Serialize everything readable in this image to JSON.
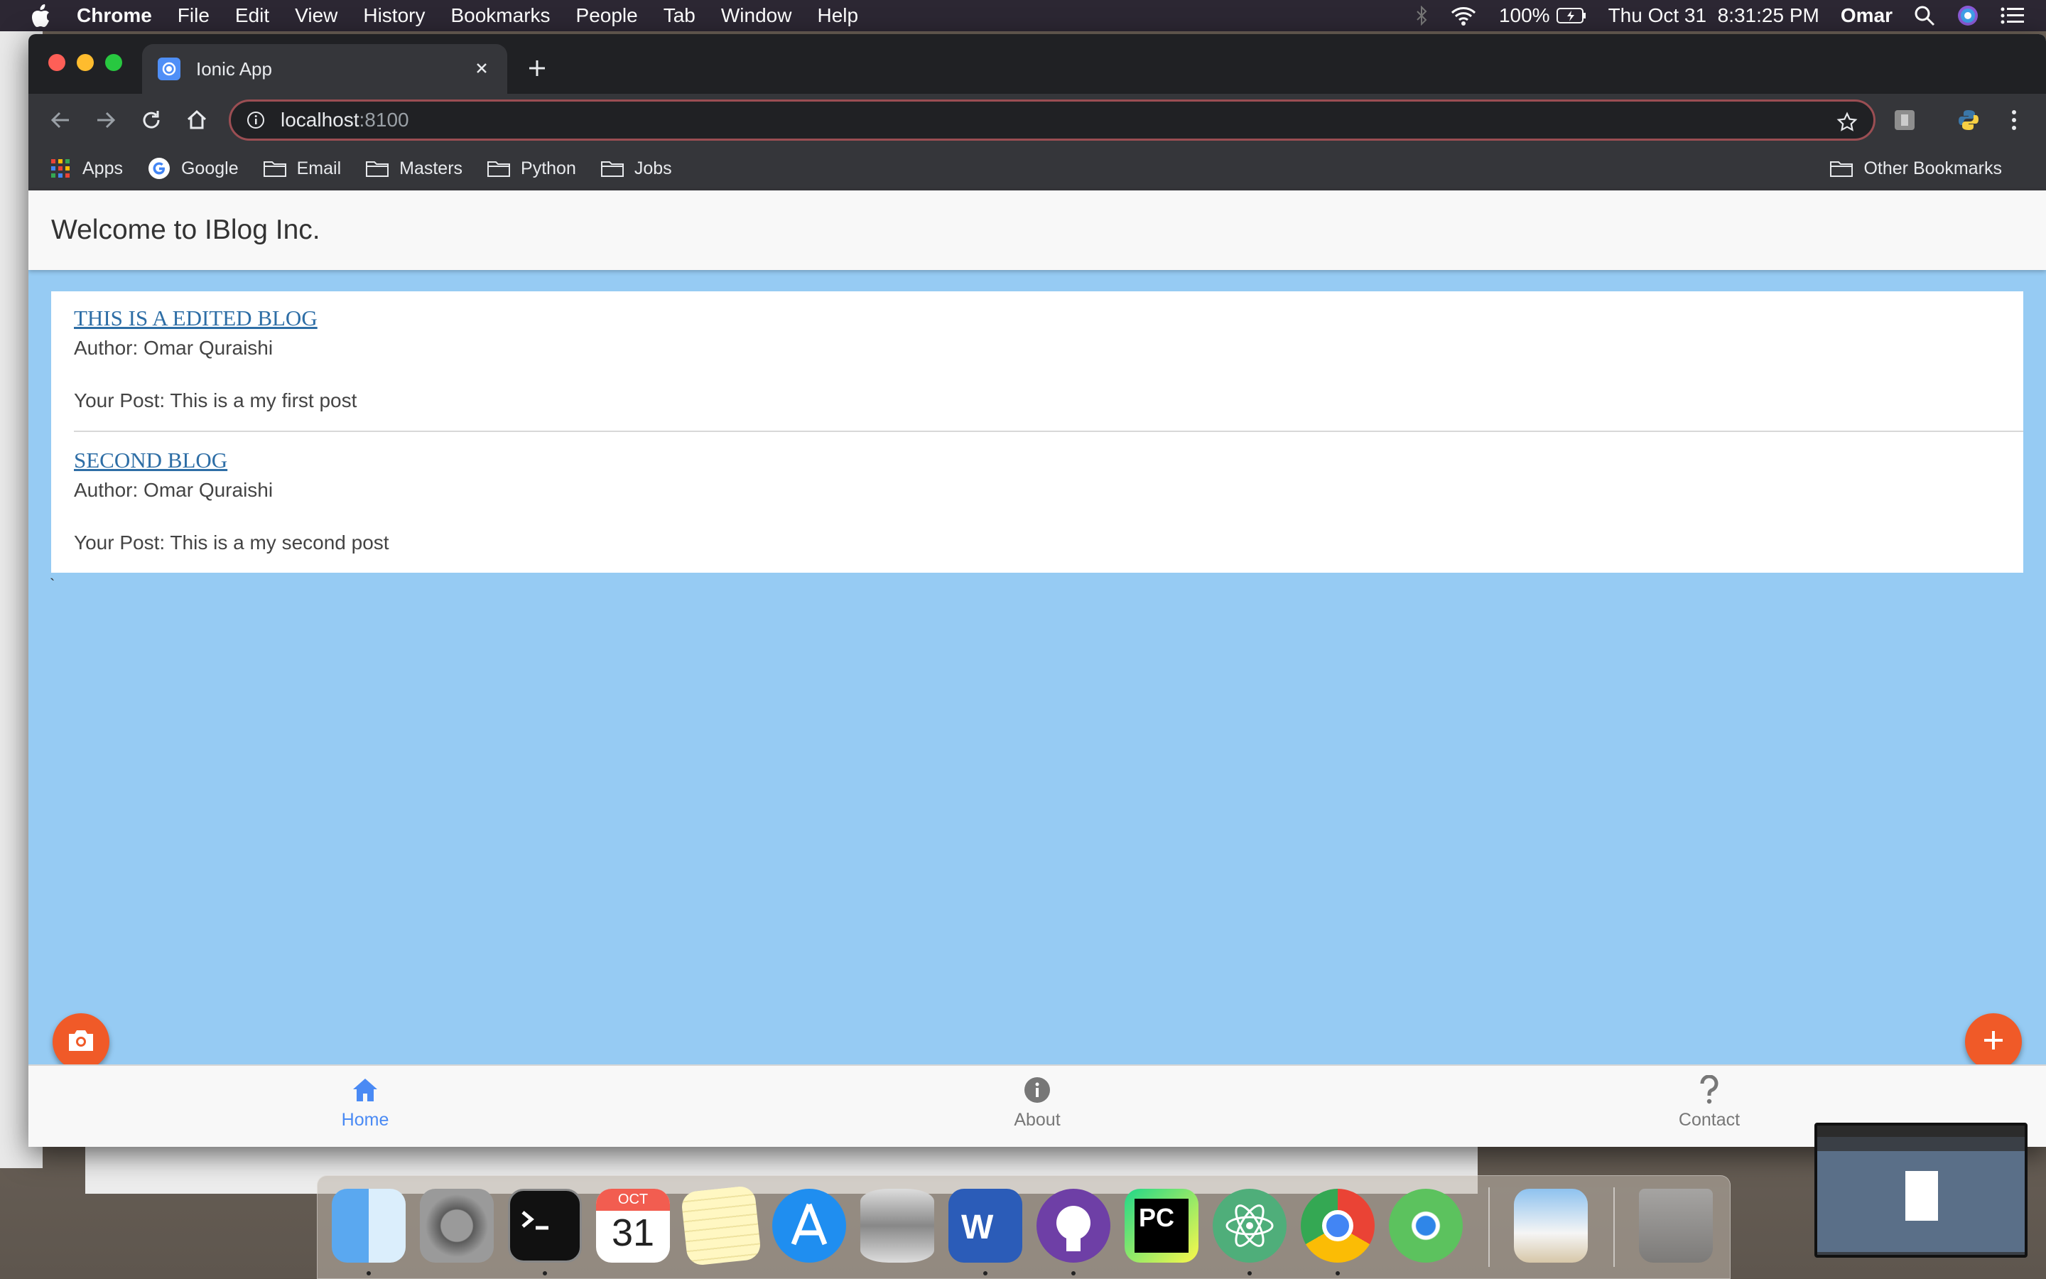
{
  "menubar": {
    "app_name": "Chrome",
    "menus": [
      "File",
      "Edit",
      "View",
      "History",
      "Bookmarks",
      "People",
      "Tab",
      "Window",
      "Help"
    ],
    "battery": "100%",
    "datetime": "Thu Oct 31  8:31:25 PM",
    "user": "Omar"
  },
  "browser": {
    "tab_title": "Ionic App",
    "url_host": "localhost",
    "url_port": ":8100",
    "bookmarks": [
      "Apps",
      "Google",
      "Email",
      "Masters",
      "Python",
      "Jobs"
    ],
    "other_bookmarks": "Other Bookmarks"
  },
  "app": {
    "header_title": "Welcome to IBlog Inc.",
    "posts": [
      {
        "title": "THIS IS A EDITED BLOG",
        "author": "Author: Omar Quraishi",
        "body": "Your Post: This is a my first post"
      },
      {
        "title": "SECOND BLOG",
        "author": "Author: Omar Quraishi",
        "body": "Your Post: This is a my second post"
      }
    ],
    "stray_char": "`",
    "tabs": [
      {
        "label": "Home",
        "icon": "home-icon",
        "active": true
      },
      {
        "label": "About",
        "icon": "info-icon",
        "active": false
      },
      {
        "label": "Contact",
        "icon": "question-icon",
        "active": false
      }
    ],
    "colors": {
      "content_bg": "#96cbf3",
      "fab": "#f05a28",
      "active_tab": "#4a8af4",
      "link": "#2e6ea6"
    }
  },
  "dock": {
    "calendar_month": "OCT",
    "calendar_day": "31",
    "apps": [
      "finder",
      "system-preferences",
      "terminal",
      "calendar",
      "notes",
      "app-store",
      "database",
      "word",
      "github-desktop",
      "pycharm",
      "atom",
      "chrome",
      "find-my",
      "preview",
      "trash"
    ]
  }
}
